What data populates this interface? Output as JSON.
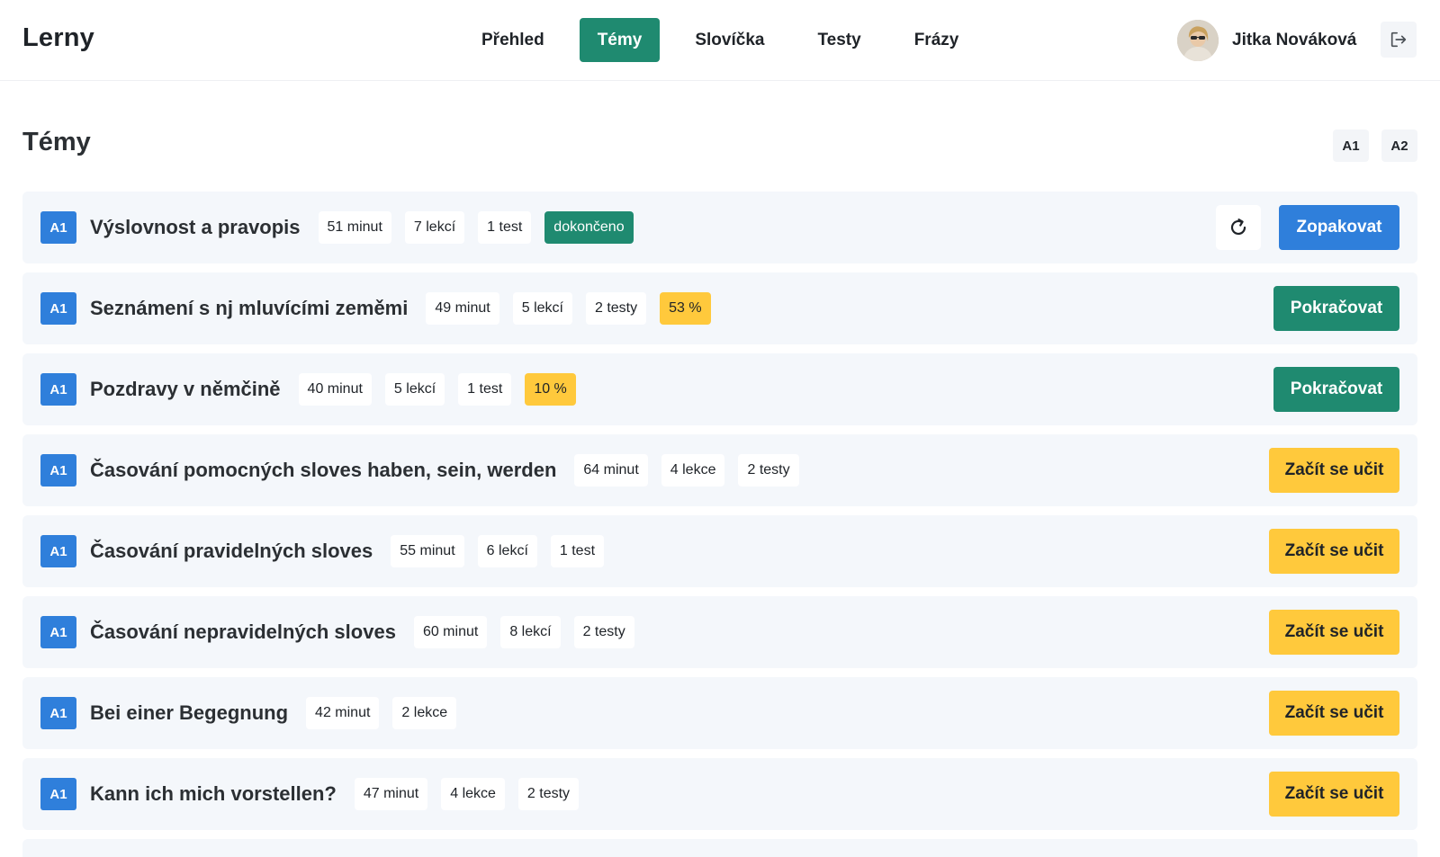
{
  "app": {
    "brand": "Lerny"
  },
  "nav": [
    {
      "label": "Přehled",
      "active": false
    },
    {
      "label": "Témy",
      "active": true
    },
    {
      "label": "Slovíčka",
      "active": false
    },
    {
      "label": "Testy",
      "active": false
    },
    {
      "label": "Frázy",
      "active": false
    }
  ],
  "user": {
    "name": "Jitka Nováková",
    "avatar_icon": "user-avatar",
    "logout_icon": "logout-icon"
  },
  "page": {
    "title": "Témy",
    "level_filters": [
      "A1",
      "A2"
    ]
  },
  "colors": {
    "primary_green": "#1f8a70",
    "primary_blue": "#2f7fdb",
    "accent_yellow": "#ffc93c",
    "row_bg": "#f4f7fb"
  },
  "topics": [
    {
      "level": "A1",
      "title": "Výslovnost a pravopis",
      "duration": "51 minut",
      "lessons": "7 lekcí",
      "tests": "1 test",
      "status": "dokončeno",
      "status_type": "done",
      "has_repeat_icon": true,
      "action": "Zopakovat",
      "action_type": "blue"
    },
    {
      "level": "A1",
      "title": "Seznámení s nj mluvícími zeměmi",
      "duration": "49 minut",
      "lessons": "5 lekcí",
      "tests": "2 testy",
      "status": "53 %",
      "status_type": "progress",
      "has_repeat_icon": false,
      "action": "Pokračovat",
      "action_type": "green"
    },
    {
      "level": "A1",
      "title": "Pozdravy v němčině",
      "duration": "40 minut",
      "lessons": "5 lekcí",
      "tests": "1 test",
      "status": "10 %",
      "status_type": "progress",
      "has_repeat_icon": false,
      "action": "Pokračovat",
      "action_type": "green"
    },
    {
      "level": "A1",
      "title": "Časování pomocných sloves haben, sein, werden",
      "duration": "64 minut",
      "lessons": "4 lekce",
      "tests": "2 testy",
      "status": "",
      "status_type": "none",
      "has_repeat_icon": false,
      "action": "Začít se učit",
      "action_type": "yellow"
    },
    {
      "level": "A1",
      "title": "Časování pravidelných sloves",
      "duration": "55 minut",
      "lessons": "6 lekcí",
      "tests": "1 test",
      "status": "",
      "status_type": "none",
      "has_repeat_icon": false,
      "action": "Začít se učit",
      "action_type": "yellow"
    },
    {
      "level": "A1",
      "title": "Časování nepravidelných sloves",
      "duration": "60 minut",
      "lessons": "8 lekcí",
      "tests": "2 testy",
      "status": "",
      "status_type": "none",
      "has_repeat_icon": false,
      "action": "Začít se učit",
      "action_type": "yellow"
    },
    {
      "level": "A1",
      "title": "Bei einer Begegnung",
      "duration": "42 minut",
      "lessons": "2 lekce",
      "tests": "",
      "status": "",
      "status_type": "none",
      "has_repeat_icon": false,
      "action": "Začít se učit",
      "action_type": "yellow"
    },
    {
      "level": "A1",
      "title": "Kann ich mich vorstellen?",
      "duration": "47 minut",
      "lessons": "4 lekce",
      "tests": "2 testy",
      "status": "",
      "status_type": "none",
      "has_repeat_icon": false,
      "action": "Začít se učit",
      "action_type": "yellow"
    }
  ]
}
